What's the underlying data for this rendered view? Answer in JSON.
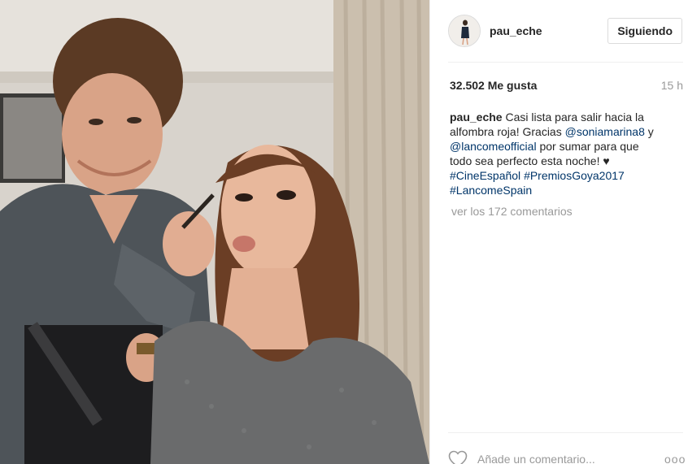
{
  "post": {
    "username": "pau_eche",
    "follow_label": "Siguiendo",
    "likes": "32.502 Me gusta",
    "time": "15 h",
    "caption": {
      "user": "pau_eche",
      "t1": " Casi lista para salir hacia la alfombra roja! Gracias ",
      "m1": "@soniamarina8",
      "t2": " y ",
      "m2": "@lancomeofficial",
      "t3": " por sumar para que todo sea perfecto esta noche! ♥ ",
      "h1": "#CineEspañol",
      "t4": " ",
      "h2": "#PremiosGoya2017",
      "t5": " ",
      "h3": "#LancomeSpain"
    },
    "view_comments": "ver los 172 comentarios",
    "comment_placeholder": "Añade un comentario...",
    "more_label": "ooo"
  },
  "icons": {
    "like": "heart-outline-icon",
    "more": "more-dots-icon"
  },
  "colors": {
    "link": "#003569",
    "muted": "#999999",
    "text": "#262626"
  }
}
